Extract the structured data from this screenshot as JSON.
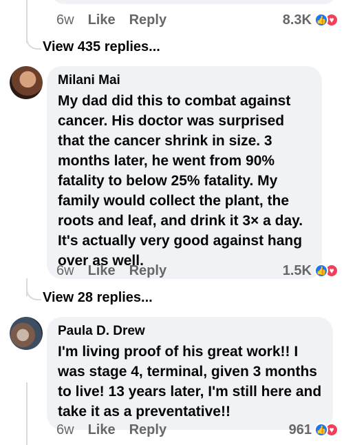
{
  "previous_comment": {
    "time": "6w",
    "like_label": "Like",
    "reply_label": "Reply",
    "reaction_count": "8.3K"
  },
  "replies_1": {
    "label": "View 435 replies..."
  },
  "comments": [
    {
      "author": "Milani Mai",
      "text": "My dad did this to combat against cancer. His doctor was surprised that the cancer shrink in size. 3 months later, he went from 90% fatality to below 25% fatality. My family would collect the plant, the roots and leaf, and drink it 3× a day. It's actually very good against hang over as well.",
      "time": "6w",
      "like_label": "Like",
      "reply_label": "Reply",
      "reaction_count": "1.5K",
      "replies_label": "View 28 replies..."
    },
    {
      "author": "Paula D. Drew",
      "text": "I'm living proof of his great work!! I was stage 4, terminal, given 3 months to live! 13 years later, I'm still here and take it as a preventative!!",
      "time": "6w",
      "like_label": "Like",
      "reply_label": "Reply",
      "reaction_count": "961"
    }
  ],
  "icons": {
    "like_reaction": "thumbs-up-icon",
    "love_reaction": "heart-icon"
  },
  "colors": {
    "bubble": "#f0f2f5",
    "meta": "#65676b",
    "like": "#1877f2",
    "love": "#f33e58"
  }
}
